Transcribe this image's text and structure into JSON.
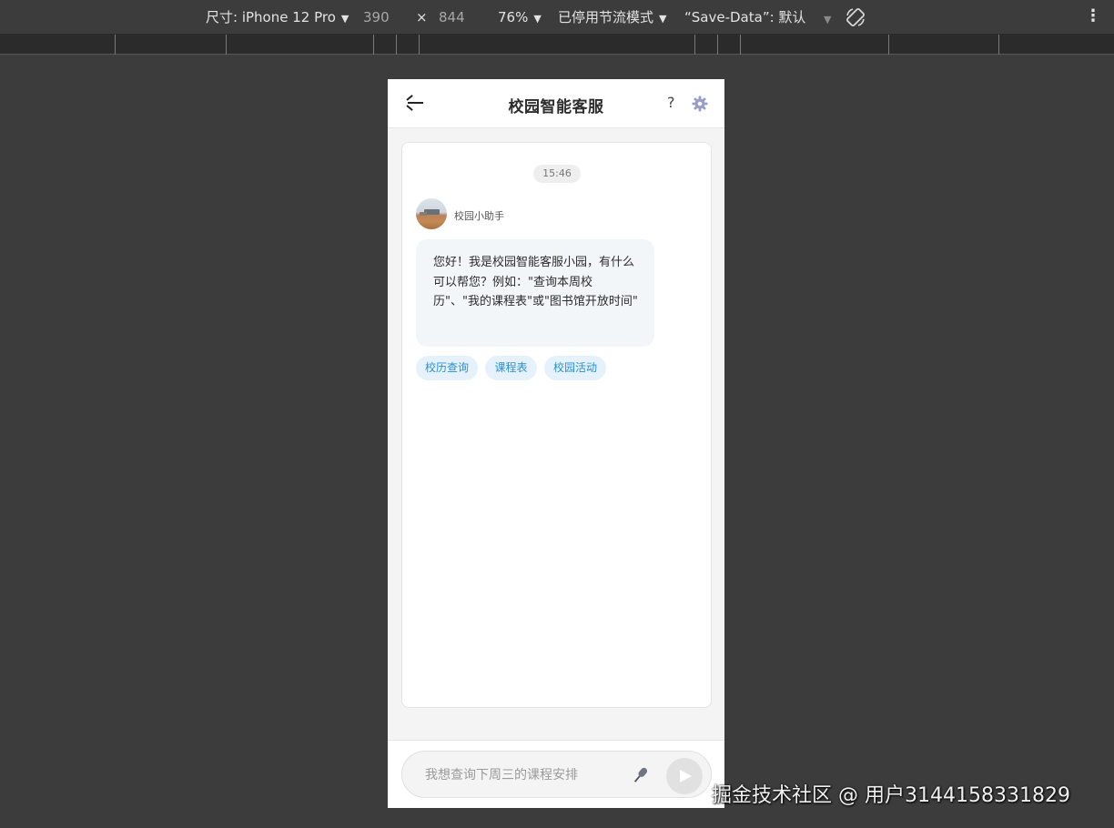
{
  "devtools": {
    "device_label": "尺寸: iPhone 12 Pro",
    "width": "390",
    "times": "×",
    "height": "844",
    "zoom": "76%",
    "throttle": "已停用节流模式",
    "save_data": "“Save-Data”: 默认",
    "more": "⋮"
  },
  "app": {
    "title": "校园智能客服",
    "help": "?"
  },
  "chat": {
    "time": "15:46",
    "bot_name": "校园小助手",
    "message": "您好！我是校园智能客服小园，有什么可以帮您？例如：\"查询本周校历\"、\"我的课程表\"或\"图书馆开放时间\"",
    "chips": [
      {
        "label": "校历查询"
      },
      {
        "label": "课程表"
      },
      {
        "label": "校园活动"
      }
    ]
  },
  "input": {
    "placeholder": "我想查询下周三的课程安排",
    "value": ""
  },
  "watermark": "掘金技术社区 @ 用户3144158331829"
}
